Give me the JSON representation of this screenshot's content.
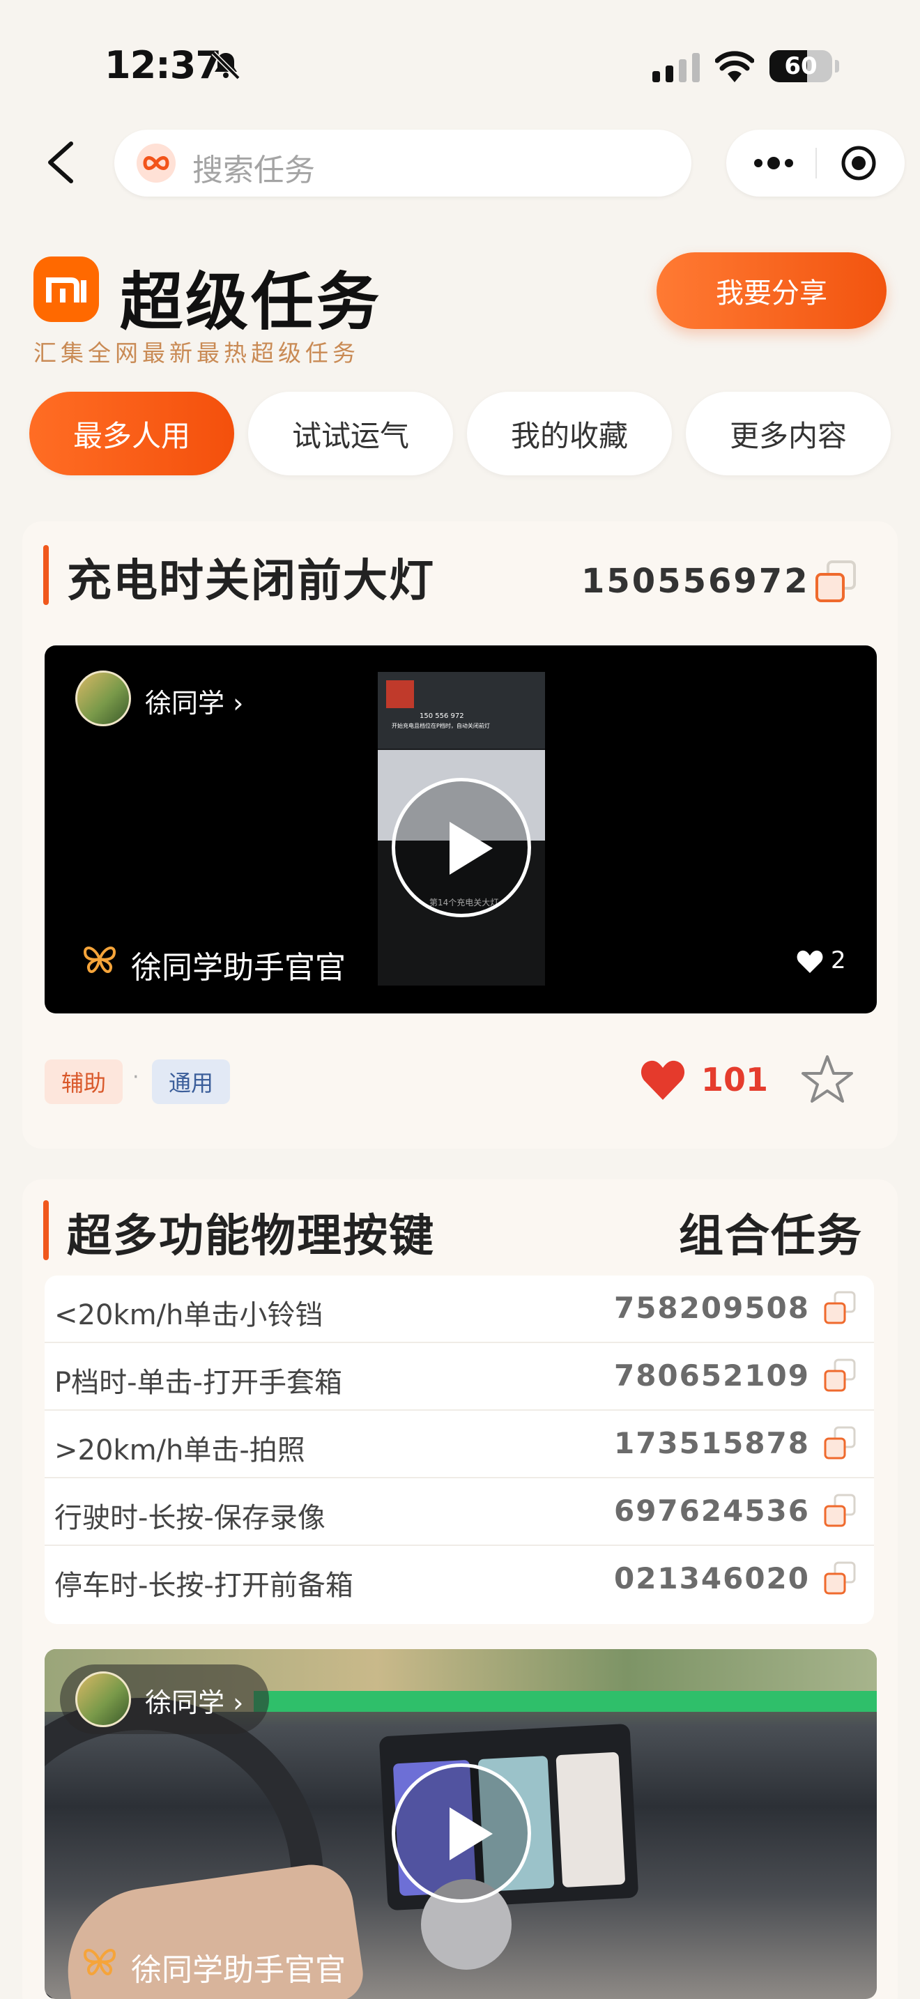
{
  "status_bar": {
    "time": "12:37",
    "battery": "60",
    "battery_level": 0.6
  },
  "nav": {
    "search_placeholder": "搜索任务"
  },
  "header": {
    "title": "超级任务",
    "subtitle": "汇集全网最新最热超级任务",
    "share_label": "我要分享",
    "logo_text": "mi"
  },
  "tabs": [
    {
      "label": "最多人用",
      "active": true
    },
    {
      "label": "试试运气",
      "active": false
    },
    {
      "label": "我的收藏",
      "active": false
    },
    {
      "label": "更多内容",
      "active": false
    }
  ],
  "card1": {
    "title": "充电时关闭前大灯",
    "code": "150556972",
    "video": {
      "author": "徐同学 ›",
      "brand": "徐同学助手官官",
      "likes": "2",
      "overlay_code": "150 556 972",
      "overlay_line": "开始充电且档位在P档时，自动关闭前灯",
      "caption": "第14个充电关大灯"
    },
    "tags": [
      "辅助",
      "通用"
    ],
    "tag_separator": "·",
    "favorites": "101"
  },
  "card2": {
    "title": "超多功能物理按键",
    "badge": "组合任务",
    "items": [
      {
        "label": "<20km/h单击小铃铛",
        "code": "758209508"
      },
      {
        "label": "P档时-单击-打开手套箱",
        "code": "780652109"
      },
      {
        "label": ">20km/h单击-拍照",
        "code": "173515878"
      },
      {
        "label": "行驶时-长按-保存录像",
        "code": "697624536"
      },
      {
        "label": "停车时-长按-打开前备箱",
        "code": "021346020"
      }
    ],
    "video": {
      "author": "徐同学 ›",
      "brand": "徐同学助手官官"
    }
  }
}
